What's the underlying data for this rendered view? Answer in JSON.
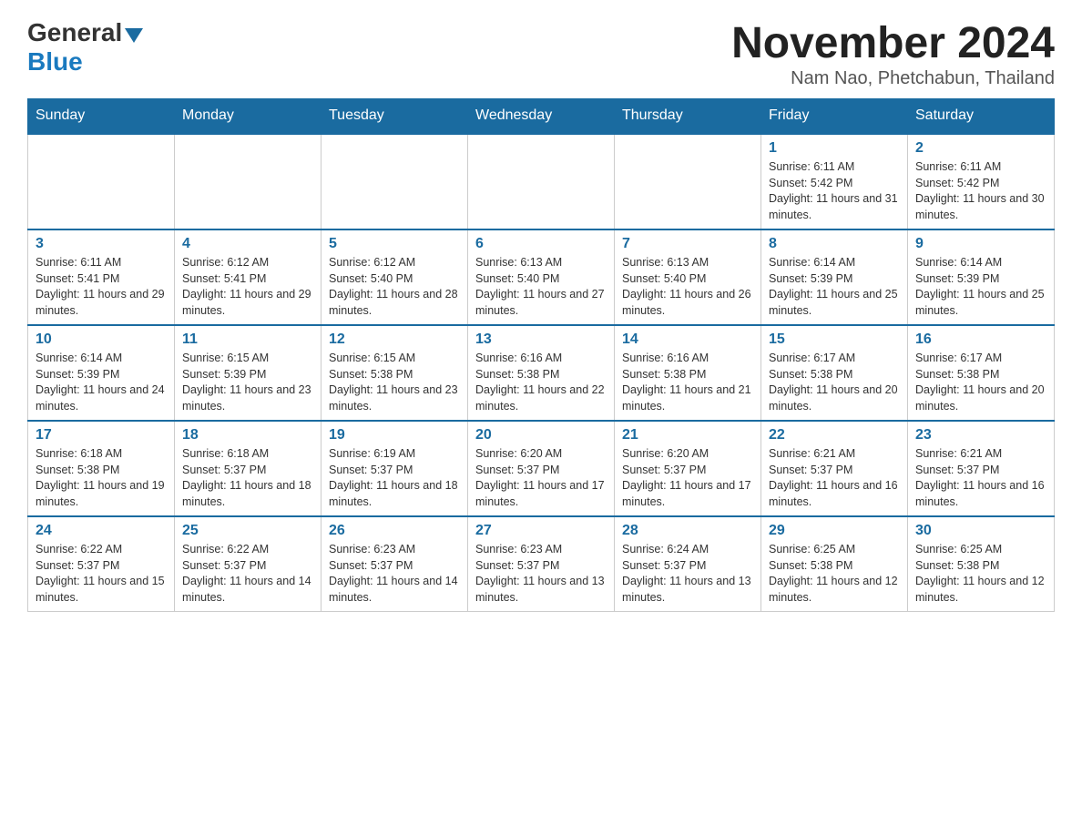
{
  "header": {
    "logo_general": "General",
    "logo_blue": "Blue",
    "title": "November 2024",
    "location": "Nam Nao, Phetchabun, Thailand"
  },
  "days_of_week": [
    "Sunday",
    "Monday",
    "Tuesday",
    "Wednesday",
    "Thursday",
    "Friday",
    "Saturday"
  ],
  "weeks": [
    {
      "days": [
        {
          "num": "",
          "info": ""
        },
        {
          "num": "",
          "info": ""
        },
        {
          "num": "",
          "info": ""
        },
        {
          "num": "",
          "info": ""
        },
        {
          "num": "",
          "info": ""
        },
        {
          "num": "1",
          "info": "Sunrise: 6:11 AM\nSunset: 5:42 PM\nDaylight: 11 hours and 31 minutes."
        },
        {
          "num": "2",
          "info": "Sunrise: 6:11 AM\nSunset: 5:42 PM\nDaylight: 11 hours and 30 minutes."
        }
      ]
    },
    {
      "days": [
        {
          "num": "3",
          "info": "Sunrise: 6:11 AM\nSunset: 5:41 PM\nDaylight: 11 hours and 29 minutes."
        },
        {
          "num": "4",
          "info": "Sunrise: 6:12 AM\nSunset: 5:41 PM\nDaylight: 11 hours and 29 minutes."
        },
        {
          "num": "5",
          "info": "Sunrise: 6:12 AM\nSunset: 5:40 PM\nDaylight: 11 hours and 28 minutes."
        },
        {
          "num": "6",
          "info": "Sunrise: 6:13 AM\nSunset: 5:40 PM\nDaylight: 11 hours and 27 minutes."
        },
        {
          "num": "7",
          "info": "Sunrise: 6:13 AM\nSunset: 5:40 PM\nDaylight: 11 hours and 26 minutes."
        },
        {
          "num": "8",
          "info": "Sunrise: 6:14 AM\nSunset: 5:39 PM\nDaylight: 11 hours and 25 minutes."
        },
        {
          "num": "9",
          "info": "Sunrise: 6:14 AM\nSunset: 5:39 PM\nDaylight: 11 hours and 25 minutes."
        }
      ]
    },
    {
      "days": [
        {
          "num": "10",
          "info": "Sunrise: 6:14 AM\nSunset: 5:39 PM\nDaylight: 11 hours and 24 minutes."
        },
        {
          "num": "11",
          "info": "Sunrise: 6:15 AM\nSunset: 5:39 PM\nDaylight: 11 hours and 23 minutes."
        },
        {
          "num": "12",
          "info": "Sunrise: 6:15 AM\nSunset: 5:38 PM\nDaylight: 11 hours and 23 minutes."
        },
        {
          "num": "13",
          "info": "Sunrise: 6:16 AM\nSunset: 5:38 PM\nDaylight: 11 hours and 22 minutes."
        },
        {
          "num": "14",
          "info": "Sunrise: 6:16 AM\nSunset: 5:38 PM\nDaylight: 11 hours and 21 minutes."
        },
        {
          "num": "15",
          "info": "Sunrise: 6:17 AM\nSunset: 5:38 PM\nDaylight: 11 hours and 20 minutes."
        },
        {
          "num": "16",
          "info": "Sunrise: 6:17 AM\nSunset: 5:38 PM\nDaylight: 11 hours and 20 minutes."
        }
      ]
    },
    {
      "days": [
        {
          "num": "17",
          "info": "Sunrise: 6:18 AM\nSunset: 5:38 PM\nDaylight: 11 hours and 19 minutes."
        },
        {
          "num": "18",
          "info": "Sunrise: 6:18 AM\nSunset: 5:37 PM\nDaylight: 11 hours and 18 minutes."
        },
        {
          "num": "19",
          "info": "Sunrise: 6:19 AM\nSunset: 5:37 PM\nDaylight: 11 hours and 18 minutes."
        },
        {
          "num": "20",
          "info": "Sunrise: 6:20 AM\nSunset: 5:37 PM\nDaylight: 11 hours and 17 minutes."
        },
        {
          "num": "21",
          "info": "Sunrise: 6:20 AM\nSunset: 5:37 PM\nDaylight: 11 hours and 17 minutes."
        },
        {
          "num": "22",
          "info": "Sunrise: 6:21 AM\nSunset: 5:37 PM\nDaylight: 11 hours and 16 minutes."
        },
        {
          "num": "23",
          "info": "Sunrise: 6:21 AM\nSunset: 5:37 PM\nDaylight: 11 hours and 16 minutes."
        }
      ]
    },
    {
      "days": [
        {
          "num": "24",
          "info": "Sunrise: 6:22 AM\nSunset: 5:37 PM\nDaylight: 11 hours and 15 minutes."
        },
        {
          "num": "25",
          "info": "Sunrise: 6:22 AM\nSunset: 5:37 PM\nDaylight: 11 hours and 14 minutes."
        },
        {
          "num": "26",
          "info": "Sunrise: 6:23 AM\nSunset: 5:37 PM\nDaylight: 11 hours and 14 minutes."
        },
        {
          "num": "27",
          "info": "Sunrise: 6:23 AM\nSunset: 5:37 PM\nDaylight: 11 hours and 13 minutes."
        },
        {
          "num": "28",
          "info": "Sunrise: 6:24 AM\nSunset: 5:37 PM\nDaylight: 11 hours and 13 minutes."
        },
        {
          "num": "29",
          "info": "Sunrise: 6:25 AM\nSunset: 5:38 PM\nDaylight: 11 hours and 12 minutes."
        },
        {
          "num": "30",
          "info": "Sunrise: 6:25 AM\nSunset: 5:38 PM\nDaylight: 11 hours and 12 minutes."
        }
      ]
    }
  ]
}
